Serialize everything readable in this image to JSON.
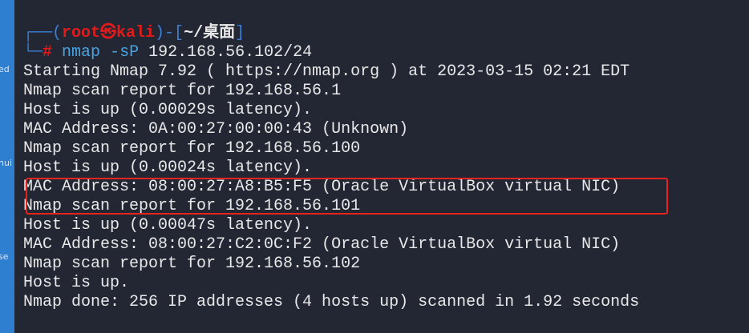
{
  "desktop": {
    "labels": [
      "ed",
      "hui",
      "se"
    ]
  },
  "prompt": {
    "user": "root",
    "symbol": "㉿",
    "host": "kali",
    "dir": "~/桌面",
    "hash": "#",
    "command": "nmap",
    "flags": "-sP",
    "target": "192.168.56.102/24"
  },
  "output": [
    "Starting Nmap 7.92 ( https://nmap.org ) at 2023-03-15 02:21 EDT",
    "Nmap scan report for 192.168.56.1",
    "Host is up (0.00029s latency).",
    "MAC Address: 0A:00:27:00:00:43 (Unknown)",
    "Nmap scan report for 192.168.56.100",
    "Host is up (0.00024s latency).",
    "MAC Address: 08:00:27:A8:B5:F5 (Oracle VirtualBox virtual NIC)",
    "Nmap scan report for 192.168.56.101",
    "Host is up (0.00047s latency).",
    "MAC Address: 08:00:27:C2:0C:F2 (Oracle VirtualBox virtual NIC)",
    "Nmap scan report for 192.168.56.102",
    "Host is up.",
    "Nmap done: 256 IP addresses (4 hosts up) scanned in 1.92 seconds"
  ],
  "colors": {
    "highlight": "#e8231e",
    "background": "#222733"
  }
}
